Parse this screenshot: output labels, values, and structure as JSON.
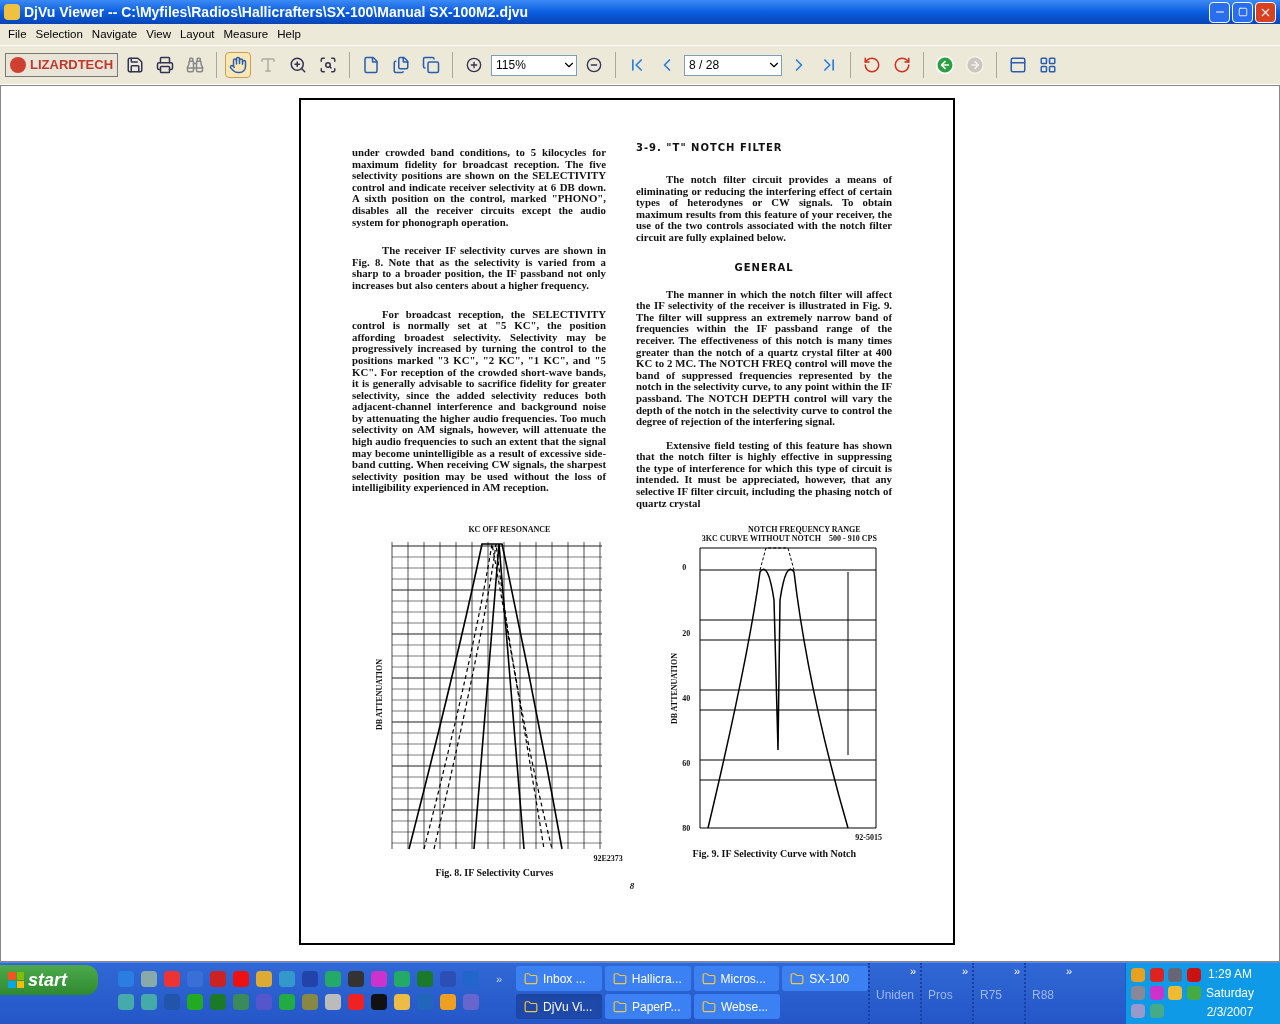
{
  "window": {
    "title": "DjVu Viewer -- C:\\Myfiles\\Radios\\Hallicrafters\\SX-100\\Manual SX-100M2.djvu"
  },
  "menu": [
    "File",
    "Selection",
    "Navigate",
    "View",
    "Layout",
    "Measure",
    "Help"
  ],
  "toolbar": {
    "logo": "LIZARDTECH",
    "hand_tool_selected": true,
    "text_tool_disabled": true,
    "forward_disabled": true,
    "zoom": "115%",
    "page": "8 / 28"
  },
  "document": {
    "left_column": [
      "under crowded band conditions, to 5 kilocycles for maximum fidelity for broadcast reception. The five selectivity positions are shown on the SELECTIVITY control and indicate receiver selectivity at 6 DB down. A sixth position on the control, marked \"PHONO\", disables all the receiver circuits except the audio system for phonograph operation.",
      "The receiver IF selectivity curves are shown in Fig. 8. Note that as the selectivity is varied from a sharp to a broader position, the IF passband not only increases but also centers about a higher frequency.",
      "For broadcast reception, the SELECTIVITY control is normally set at \"5 KC\", the position affording broadest selectivity. Selectivity may be progressively increased by turning the control to the positions marked \"3 KC\", \"2 KC\", \"1 KC\", and \"5 KC\". For reception of the crowded short-wave bands, it is generally advisable to sacrifice fidelity for greater selectivity, since the added selectivity reduces both adjacent-channel interference and background noise by attenuating the higher audio frequencies. Too much selectivity on AM signals, however, will attenuate the high audio frequencies to such an extent that the signal may become unintelligible as a result of excessive side-band cutting. When receiving CW signals, the sharpest selectivity position may be used without the loss of intelligibility experienced in AM reception."
    ],
    "right_heading": "3-9.  \"T\" NOTCH FILTER",
    "right_intro": "The notch filter circuit provides a means of eliminating or reducing the interfering effect of certain types of heterodynes or CW signals. To obtain maximum results from this feature of your receiver, the use of the two controls associated with the notch filter circuit are fully explained below.",
    "subheading": "GENERAL",
    "right_paragraphs": [
      "The manner in which the notch filter will affect the IF selectivity of the receiver is illustrated in Fig. 9. The filter will suppress an extremely narrow band of frequencies within the IF passband range of the receiver. The effectiveness of this notch is many times greater than the notch of a quartz crystal filter at 400 KC to 2 MC. The NOTCH FREQ control will move the band of suppressed frequencies represented by the notch in the selectivity curve, to any point within the IF passband. The NOTCH DEPTH control will vary the depth of the notch in the selectivity curve to control the degree of rejection of the interfering signal.",
      "Extensive field testing of this feature has shown that the notch filter is highly effective in suppressing the type of interference for which this type of circuit is intended. It must be appreciated, however, that any selective IF filter circuit, including the phasing notch of quartz crystal"
    ],
    "figure_8": {
      "top_label": "KC OFF RESONANCE",
      "y_label": "DB ATTENUATION",
      "code": "92E2373",
      "caption": "Fig. 8.  IF Selectivity Curves"
    },
    "figure_9": {
      "top_label": "NOTCH FREQUENCY RANGE",
      "curve_label": "3KC CURVE WITHOUT NOTCH",
      "width_label": "500 - 910 CPS",
      "y_label": "DB ATTENUATION",
      "y_ticks": [
        "0",
        "20",
        "40",
        "60",
        "80"
      ],
      "code": "92-5015",
      "caption": "Fig. 9.  IF Selectivity Curve with Notch"
    },
    "page_number": "8"
  },
  "taskbar": {
    "start": "start",
    "quick_launch_more": "»",
    "tasks_top": [
      {
        "label": "Inbox ...",
        "selected": false
      },
      {
        "label": "Hallicra...",
        "selected": false
      },
      {
        "label": "Micros...",
        "selected": false
      },
      {
        "label": "SX-100",
        "selected": false
      }
    ],
    "tasks_bottom": [
      {
        "label": "DjVu Vi...",
        "selected": true
      },
      {
        "label": "PaperP...",
        "selected": false
      },
      {
        "label": "Webse...",
        "selected": false
      }
    ],
    "toolbars": [
      {
        "label": "Uniden",
        "more": "»"
      },
      {
        "label": "Pros",
        "more": "»"
      },
      {
        "label": "R75",
        "more": "»"
      },
      {
        "label": "R88",
        "more": "»"
      }
    ],
    "clock": {
      "time": "1:29 AM",
      "day": "Saturday",
      "date": "2/3/2007"
    }
  }
}
